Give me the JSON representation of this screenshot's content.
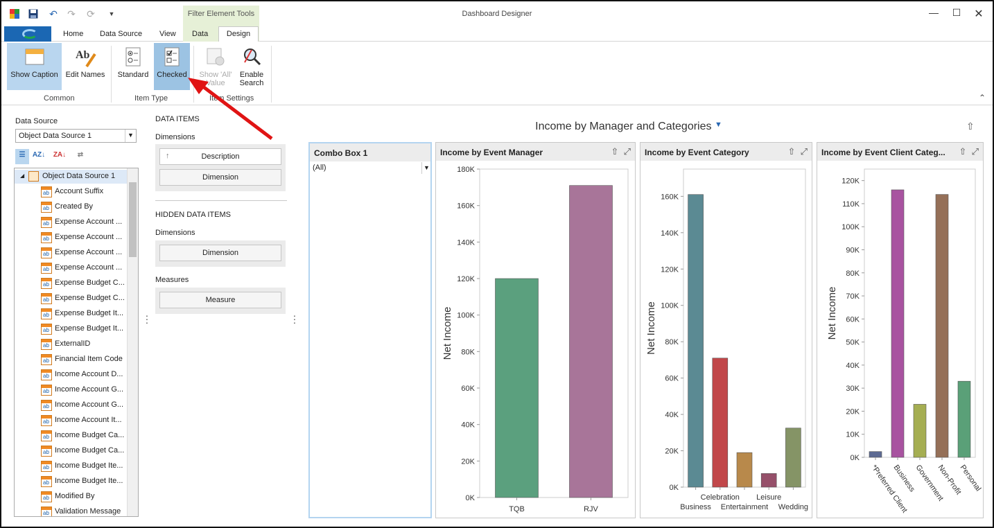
{
  "window": {
    "title": "Dashboard Designer",
    "context_group": "Filter Element Tools"
  },
  "tabs": {
    "home": "Home",
    "data_source": "Data Source",
    "view": "View",
    "data": "Data",
    "design": "Design"
  },
  "ribbon": {
    "show_caption": "Show Caption",
    "edit_names": "Edit Names",
    "standard": "Standard",
    "checked": "Checked",
    "show_all_value_1": "Show 'All'",
    "show_all_value_2": "Value",
    "enable_search_1": "Enable",
    "enable_search_2": "Search",
    "group_common": "Common",
    "group_item_type": "Item Type",
    "group_item_settings": "Item Settings"
  },
  "left": {
    "data_source_label": "Data Source",
    "data_source_value": "Object Data Source 1",
    "tree_root": "Object Data Source 1",
    "fields": [
      "Account Suffix",
      "Created By",
      "Expense Account ...",
      "Expense Account ...",
      "Expense Account ...",
      "Expense Account ...",
      "Expense Budget C...",
      "Expense Budget C...",
      "Expense Budget It...",
      "Expense Budget It...",
      "ExternalID",
      "Financial Item Code",
      "Income Account D...",
      "Income Account G...",
      "Income Account G...",
      "Income Account It...",
      "Income Budget Ca...",
      "Income Budget Ca...",
      "Income Budget Ite...",
      "Income Budget Ite...",
      "Modified By",
      "Validation Message"
    ]
  },
  "binding": {
    "data_items": "DATA ITEMS",
    "dimensions": "Dimensions",
    "description": "Description",
    "dimension": "Dimension",
    "hidden_data_items": "HIDDEN DATA ITEMS",
    "hidden_dimensions": "Dimensions",
    "hidden_dimension": "Dimension",
    "measures": "Measures",
    "measure": "Measure"
  },
  "dashboard": {
    "title": "Income by Manager and Categories",
    "combo_title": "Combo Box 1",
    "combo_value": "(All)",
    "chart1_title": "Income by Event Manager",
    "chart2_title": "Income by Event Category",
    "chart3_title": "Income by Event Client Categ..."
  },
  "chart_data": [
    {
      "type": "bar",
      "title": "Income by Event Manager",
      "ylabel": "Net Income",
      "categories": [
        "TQB",
        "RJV"
      ],
      "values": [
        120000,
        171000
      ],
      "colors": [
        "#5ba07e",
        "#a87599"
      ],
      "ylim": [
        0,
        180000
      ],
      "ticks": [
        0,
        20000,
        40000,
        60000,
        80000,
        100000,
        120000,
        140000,
        160000,
        180000
      ],
      "tick_labels": [
        "0K",
        "20K",
        "40K",
        "60K",
        "80K",
        "100K",
        "120K",
        "140K",
        "160K",
        "180K"
      ]
    },
    {
      "type": "bar",
      "title": "Income by Event Category",
      "ylabel": "Net Income",
      "categories": [
        "Business",
        "Celebration",
        "Entertainment",
        "Leisure",
        "Wedding"
      ],
      "values": [
        161000,
        71000,
        19000,
        7500,
        32500
      ],
      "colors": [
        "#5b8a93",
        "#c1474a",
        "#b8894b",
        "#96506a",
        "#859466"
      ],
      "ylim": [
        0,
        175000
      ],
      "ticks": [
        0,
        20000,
        40000,
        60000,
        80000,
        100000,
        120000,
        140000,
        160000
      ],
      "tick_labels": [
        "0K",
        "20K",
        "40K",
        "60K",
        "80K",
        "100K",
        "120K",
        "140K",
        "160K"
      ]
    },
    {
      "type": "bar",
      "title": "Income by Event Client Categ...",
      "ylabel": "Net Income",
      "categories": [
        "*Preferred Client",
        "Business",
        "Government",
        "Non-Profit",
        "Personal"
      ],
      "values": [
        2500,
        116000,
        23000,
        114000,
        33000
      ],
      "colors": [
        "#5d6a93",
        "#a853a0",
        "#a5ae52",
        "#957058",
        "#5aa078"
      ],
      "ylim": [
        0,
        125000
      ],
      "ticks": [
        0,
        10000,
        20000,
        30000,
        40000,
        50000,
        60000,
        70000,
        80000,
        90000,
        100000,
        110000,
        120000
      ],
      "tick_labels": [
        "0K",
        "10K",
        "20K",
        "30K",
        "40K",
        "50K",
        "60K",
        "70K",
        "80K",
        "90K",
        "100K",
        "110K",
        "120K"
      ]
    }
  ]
}
